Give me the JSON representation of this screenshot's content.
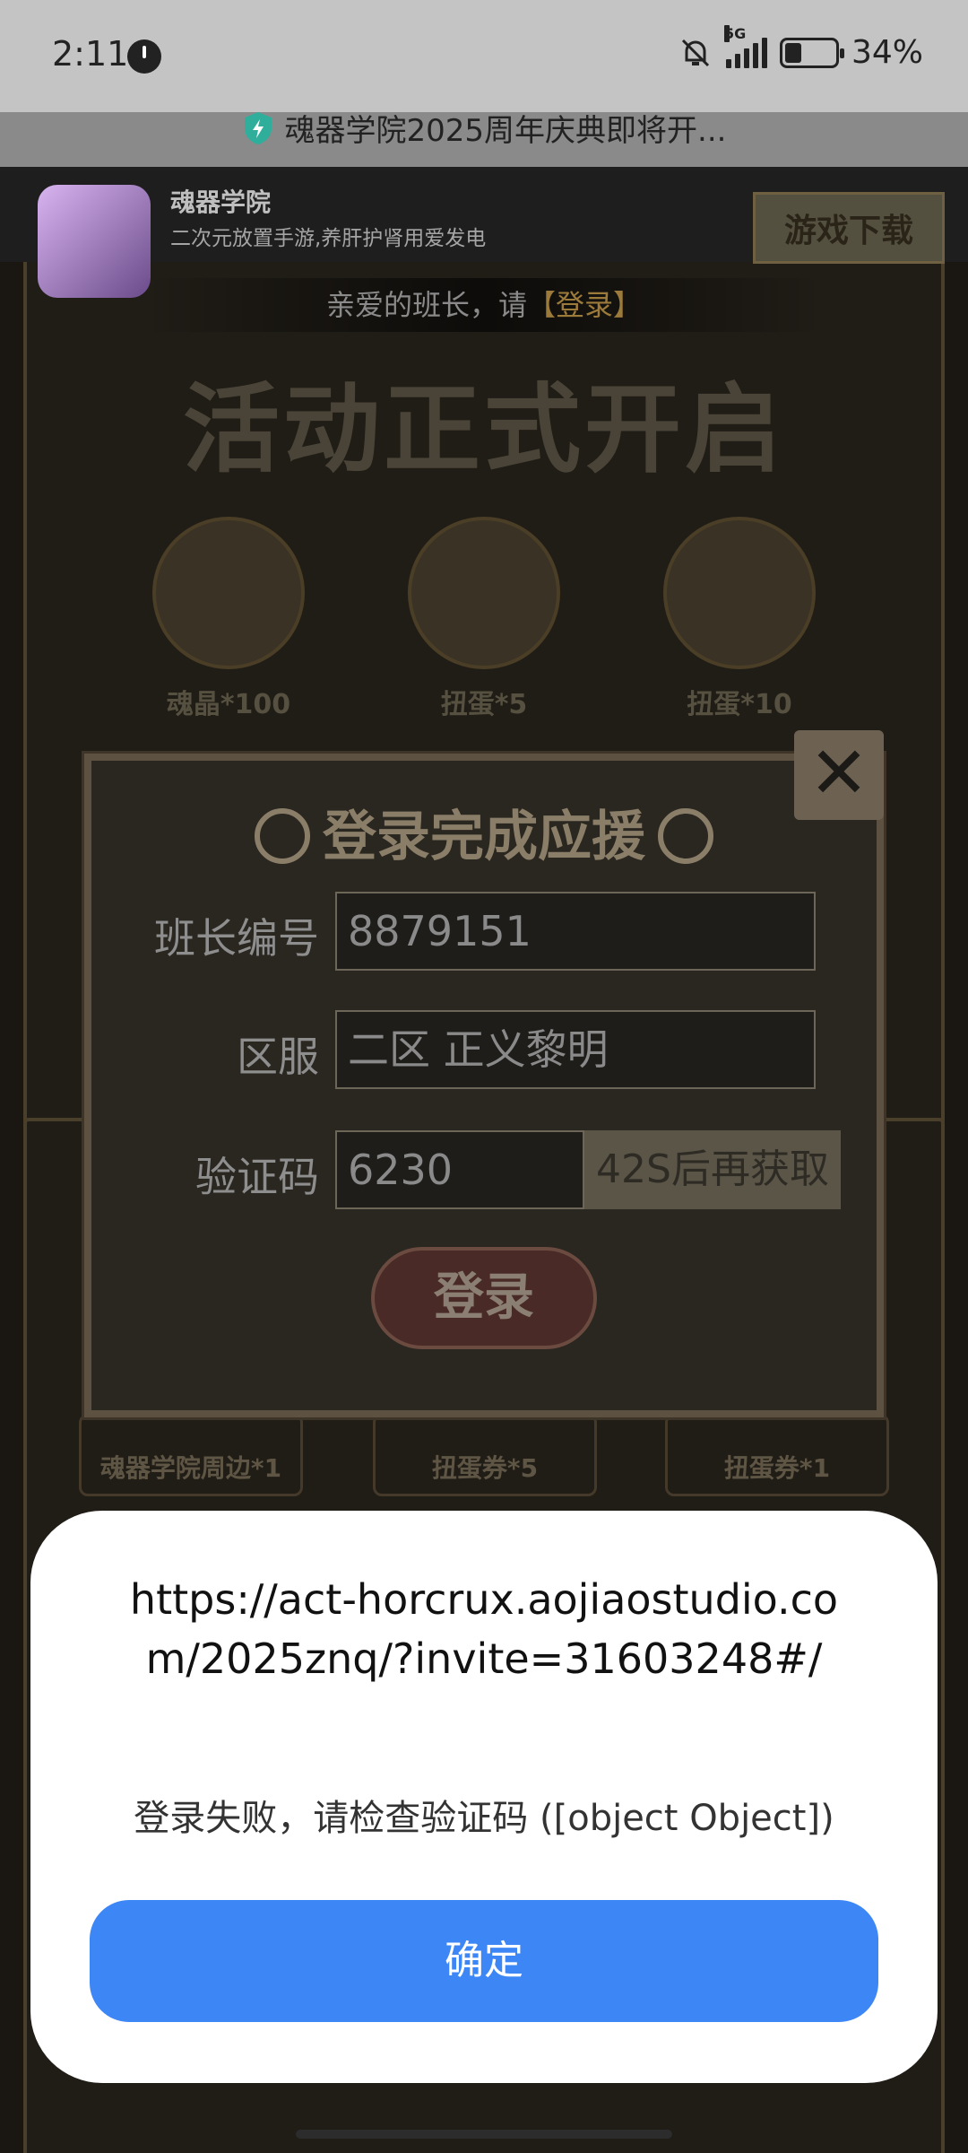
{
  "status_bar": {
    "time": "2:11",
    "network": "5G",
    "battery": "34%"
  },
  "browser": {
    "page_title": "魂器学院2025周年庆典即将开..."
  },
  "banner": {
    "app_name": "魂器学院",
    "app_desc": "二次元放置手游,养肝护肾用爱发电",
    "download_label": "游戏下载"
  },
  "page": {
    "login_hint_prefix": "亲爱的班长，请",
    "login_hint_link": "【登录】",
    "event_title": "活动正式开启",
    "rewards": [
      {
        "label": "魂晶*100"
      },
      {
        "label": "扭蛋*5"
      },
      {
        "label": "扭蛋*10"
      }
    ],
    "prizes": [
      {
        "label": "魂器学院周边*1"
      },
      {
        "label": "扭蛋券*5"
      },
      {
        "label": "扭蛋券*1"
      }
    ]
  },
  "login_dialog": {
    "title": "登录完成应援",
    "close_label": "✕",
    "fields": {
      "id_label": "班长编号",
      "id_value": "8879151",
      "server_label": "区服",
      "server_value": "二区 正义黎明",
      "code_label": "验证码",
      "code_value": "6230",
      "code_button": "42S后再获取"
    },
    "login_button": "登录"
  },
  "alert": {
    "url": "https://act-horcrux.aojiaostudio.com/2025znq/?invite=31603248#/",
    "message": "登录失败，请检查验证码 ([object Object])",
    "confirm_label": "确定"
  }
}
